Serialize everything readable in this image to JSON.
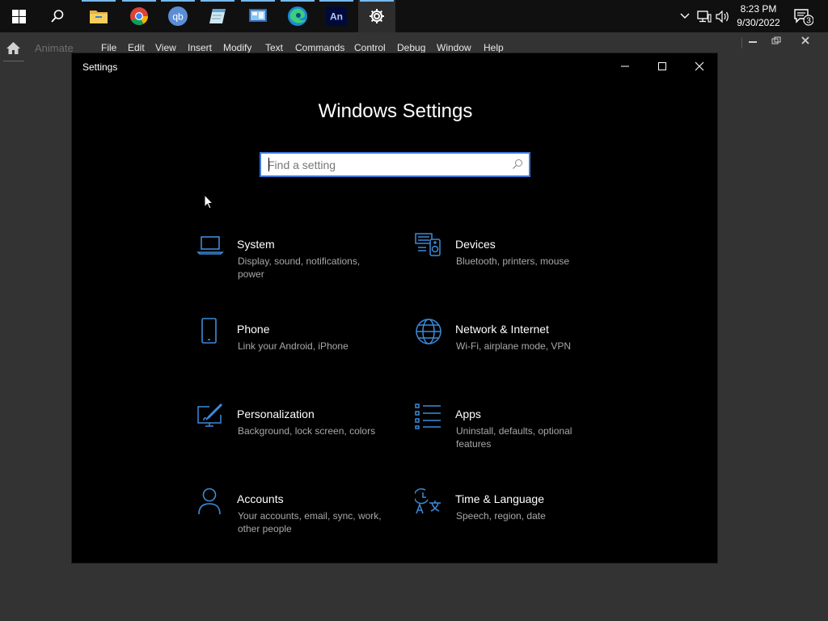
{
  "taskbar": {
    "apps": [
      {
        "name": "start-button",
        "icon": "windows-logo-icon"
      },
      {
        "name": "search-button",
        "icon": "search-icon"
      },
      {
        "name": "file-explorer",
        "icon": "folder-icon"
      },
      {
        "name": "chrome",
        "icon": "chrome-icon"
      },
      {
        "name": "qbittorrent",
        "icon": "qbittorrent-icon",
        "label": "qb"
      },
      {
        "name": "notepad",
        "icon": "notepad-icon"
      },
      {
        "name": "control-panel",
        "icon": "control-panel-icon"
      },
      {
        "name": "edge",
        "icon": "edge-icon"
      },
      {
        "name": "animate",
        "icon": "animate-icon",
        "label": "An"
      },
      {
        "name": "settings",
        "icon": "gear-icon"
      }
    ],
    "time": "8:23 PM",
    "date": "9/30/2022",
    "notification_count": "3"
  },
  "app": {
    "name": "Animate",
    "menu": [
      "File",
      "Edit",
      "View",
      "Insert",
      "Modify",
      "Text",
      "Commands",
      "Control",
      "Debug",
      "Window",
      "Help"
    ]
  },
  "settings": {
    "window_title": "Settings",
    "heading": "Windows Settings",
    "search_placeholder": "Find a setting",
    "accent": "#3c8bd9",
    "tiles": [
      {
        "title": "System",
        "desc": "Display, sound, notifications, power",
        "icon": "laptop-icon"
      },
      {
        "title": "Devices",
        "desc": "Bluetooth, printers, mouse",
        "icon": "devices-icon"
      },
      {
        "title": "Phone",
        "desc": "Link your Android, iPhone",
        "icon": "phone-icon"
      },
      {
        "title": "Network & Internet",
        "desc": "Wi-Fi, airplane mode, VPN",
        "icon": "globe-icon"
      },
      {
        "title": "Personalization",
        "desc": "Background, lock screen, colors",
        "icon": "personalization-icon"
      },
      {
        "title": "Apps",
        "desc": "Uninstall, defaults, optional features",
        "icon": "apps-list-icon"
      },
      {
        "title": "Accounts",
        "desc": "Your accounts, email, sync, work, other people",
        "icon": "person-icon"
      },
      {
        "title": "Time & Language",
        "desc": "Speech, region, date",
        "icon": "time-language-icon"
      }
    ]
  }
}
